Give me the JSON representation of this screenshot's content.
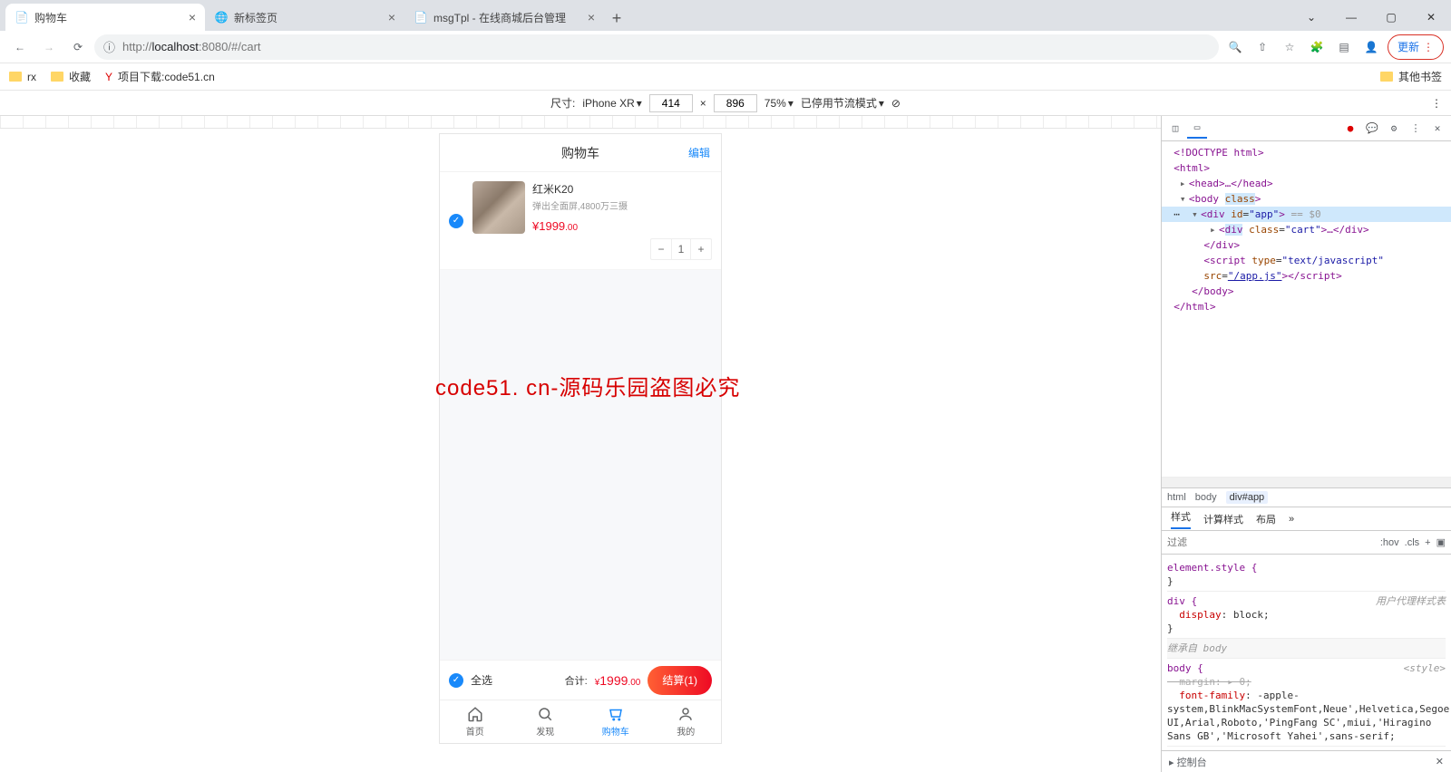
{
  "browser": {
    "tabs": [
      {
        "title": "购物车",
        "active": true
      },
      {
        "title": "新标签页",
        "active": false
      },
      {
        "title": "msgTpl - 在线商城后台管理",
        "active": false
      }
    ],
    "url_host": "localhost",
    "url_port": ":8080",
    "url_path": "/#/cart",
    "url_prefix": "http://",
    "update_label": "更新"
  },
  "bookmarks": {
    "items": [
      "rx",
      "收藏",
      "项目下载:code51.cn"
    ],
    "other": "其他书签"
  },
  "device_toolbar": {
    "size_label": "尺寸:",
    "device_name": "iPhone XR",
    "width": "414",
    "times": "×",
    "height": "896",
    "zoom": "75%",
    "throttle": "已停用节流模式"
  },
  "cart": {
    "title": "购物车",
    "edit": "编辑",
    "item": {
      "name": "红米K20",
      "desc": "弹出全面屏,4800万三摄",
      "currency": "¥",
      "price_int": "1999",
      "price_dec": ".00",
      "qty": "1"
    },
    "select_all": "全选",
    "total_label": "合计:",
    "total_currency": "¥",
    "total_int": "1999",
    "total_dec": ".00",
    "checkout": "结算(1)",
    "tabs": [
      "首页",
      "发现",
      "购物车",
      "我的"
    ]
  },
  "watermark": "code51. cn-源码乐园盗图必究",
  "devtools": {
    "dom_lines": {
      "doctype": "<!DOCTYPE html>",
      "html_open": "<html>",
      "head": "<head>…</head>",
      "body_open": "<body ",
      "body_class_attr": "class",
      "body_close_gt": ">",
      "app_open": "<div id=\"app\">",
      "app_eqdollar": " == $0",
      "cart_div": "<div class=\"cart\">…</div>",
      "div_close": "</div>",
      "script_open": "<script type=\"text/javascript\"",
      "script_src": "src=\"/app.js\"></script",
      "body_close": "</body>",
      "html_close": "</html>"
    },
    "breadcrumb": [
      "html",
      "body",
      "div#app"
    ],
    "style_tabs": [
      "样式",
      "计算样式",
      "布局"
    ],
    "filter_placeholder": "过滤",
    "hov": ":hov",
    "cls": ".cls",
    "element_style": "element.style {",
    "close_brace": "}",
    "div_rule_sel": "div {",
    "user_agent_label": "用户代理样式表",
    "display_prop": "display",
    "display_val": "block",
    "inherit_from": "继承自 body",
    "body_rule_sel": "body {",
    "style_src": "<style>",
    "margin_prop": "margin",
    "margin_val": "0",
    "ff_prop": "font-family",
    "ff_val": "-apple-system,BlinkMacSystemFont,Neue',Helvetica,Segoe UI,Arial,Roboto,'PingFang SC',miui,'Hiragino Sans GB','Microsoft Yahei',sans-serif;",
    "console_label": "控制台"
  }
}
